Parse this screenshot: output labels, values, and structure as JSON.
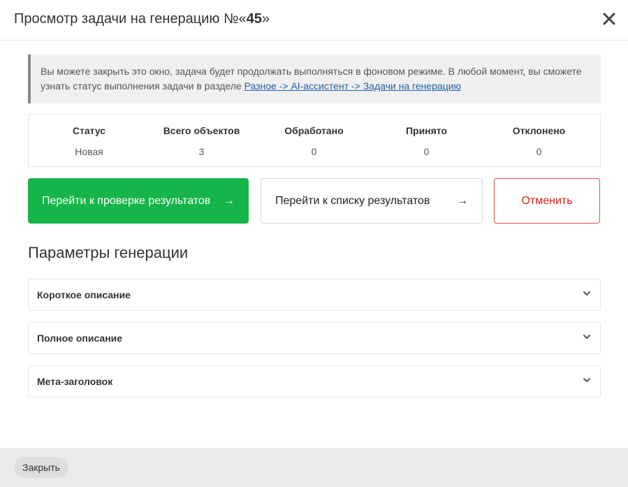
{
  "dialog": {
    "title_prefix": "Просмотр задачи на генерацию №«",
    "task_number": "45",
    "title_suffix": "»"
  },
  "notice": {
    "text": "Вы можете закрыть это окно, задача будет продолжать выполняться в фоновом режиме. В любой момент, вы сможете узнать статус выполнения задачи в разделе ",
    "link": "Разное -> AI-ассистент -> Задачи на генерацию"
  },
  "stats": [
    {
      "label": "Статус",
      "value": "Новая"
    },
    {
      "label": "Всего объектов",
      "value": "3"
    },
    {
      "label": "Обработано",
      "value": "0"
    },
    {
      "label": "Принято",
      "value": "0"
    },
    {
      "label": "Отклонено",
      "value": "0"
    }
  ],
  "actions": {
    "review_label": "Перейти к проверке результатов",
    "list_label": "Перейти к списку результатов",
    "cancel_label": "Отменить",
    "arrow": "→"
  },
  "params": {
    "title": "Параметры генерации",
    "items": [
      {
        "label": "Короткое описание"
      },
      {
        "label": "Полное описание"
      },
      {
        "label": "Мета-заголовок"
      }
    ]
  },
  "footer": {
    "close_label": "Закрыть"
  },
  "colors": {
    "primary_green": "#16b54a",
    "cancel_red": "#e01b1b",
    "link_blue": "#1f5fa8"
  },
  "icons": {
    "close": "close-icon",
    "arrow": "arrow-right-icon",
    "chevron": "chevron-down-icon"
  }
}
